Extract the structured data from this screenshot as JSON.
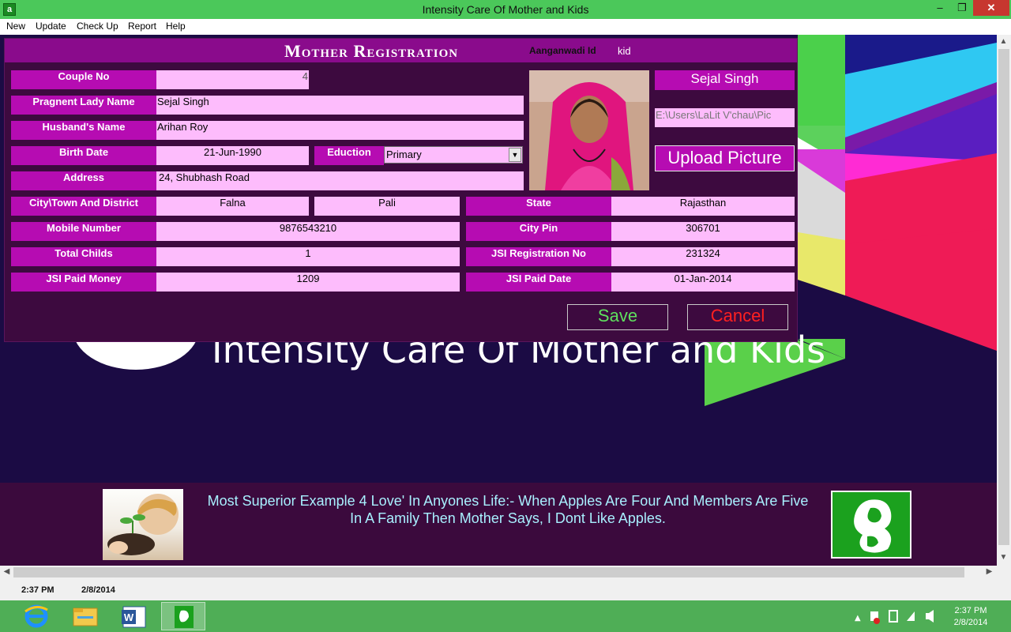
{
  "window": {
    "title": "Intensity Care Of Mother and Kids",
    "minimize": "‒",
    "restore": "❐",
    "close": "✕"
  },
  "menu": [
    "New",
    "Update",
    "Check Up",
    "Report",
    "Help"
  ],
  "background": {
    "title_text": "Intensity Care Of Mother and Kids"
  },
  "form": {
    "title": "Mother Registration",
    "aanganwadi_label": "Aanganwadi Id",
    "aanganwadi_value": "kid",
    "couple_no": {
      "label": "Couple No",
      "value": "4"
    },
    "pregnant_lady": {
      "label": "Pragnent Lady Name",
      "value": "Sejal Singh"
    },
    "husband": {
      "label": "Husband's Name",
      "value": "Arihan Roy"
    },
    "birth_date": {
      "label": "Birth Date",
      "value": "21-Jun-1990"
    },
    "education": {
      "label": "Eduction",
      "value": "Primary"
    },
    "address": {
      "label": "Address",
      "value": "24, Shubhash Road"
    },
    "city": {
      "label": "City\\Town And District",
      "town": "Falna",
      "district": "Pali"
    },
    "state": {
      "label": "State",
      "value": "Rajasthan"
    },
    "mobile": {
      "label": "Mobile Number",
      "value": "9876543210"
    },
    "city_pin": {
      "label": "City Pin",
      "value": "306701"
    },
    "total_childs": {
      "label": "Total Childs",
      "value": "1"
    },
    "jsi_reg": {
      "label": "JSI Registration No",
      "value": "231324"
    },
    "jsi_money": {
      "label": "JSI Paid Money",
      "value": "1209"
    },
    "jsi_date": {
      "label": "JSI Paid Date",
      "value": "01-Jan-2014"
    },
    "photo_name": "Sejal Singh",
    "photo_path": "E:\\Users\\LaLit V'chau\\Pic",
    "upload_label": "Upload Picture",
    "save_label": "Save",
    "cancel_label": "Cancel",
    "save_color": "#5ee05e",
    "cancel_color": "#ff2020"
  },
  "footer": {
    "quote": "Most Superior Example 4 Love' In Anyones Life:- When Apples Are Four And Members Are Five In A Family Then Mother Says, I Dont Like Apples."
  },
  "status": {
    "time": "2:37 PM",
    "date": "2/8/2014"
  },
  "taskbar": {
    "items": [
      "internet-explorer-icon",
      "file-explorer-icon",
      "word-icon",
      "app-icon"
    ],
    "clock_time": "2:37 PM",
    "clock_date": "2/8/2014"
  },
  "colors": {
    "label_bg": "#b60cb2",
    "field_bg": "#fdbcfc",
    "form_bg": "#3d0a3f",
    "header_bg": "#8a0b8c",
    "titlebar": "#4bc85a"
  }
}
